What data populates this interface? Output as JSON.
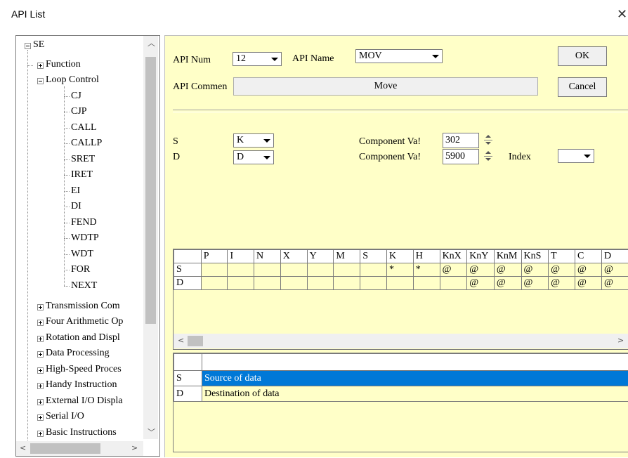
{
  "window": {
    "title": "API List",
    "close_glyph": "✕"
  },
  "tree": {
    "root": "SE",
    "items": [
      {
        "label": "Function",
        "expanded": false
      },
      {
        "label": "Loop Control",
        "expanded": true
      },
      {
        "label": "Transmission Com",
        "expanded": false
      },
      {
        "label": "Four Arithmetic Op",
        "expanded": false
      },
      {
        "label": "Rotation and Displ",
        "expanded": false
      },
      {
        "label": "Data Processing",
        "expanded": false
      },
      {
        "label": "High-Speed Proces",
        "expanded": false
      },
      {
        "label": "Handy Instruction",
        "expanded": false
      },
      {
        "label": "External I/O Displa",
        "expanded": false
      },
      {
        "label": "Serial I/O",
        "expanded": false
      },
      {
        "label": "Basic Instructions",
        "expanded": false
      }
    ],
    "children": [
      "CJ",
      "CJP",
      "CALL",
      "CALLP",
      "SRET",
      "IRET",
      "EI",
      "DI",
      "FEND",
      "WDTP",
      "WDT",
      "FOR",
      "NEXT"
    ]
  },
  "form": {
    "api_num_label": "API Num",
    "api_num_value": "12",
    "api_name_label": "API Name",
    "api_name_value": "MOV",
    "api_comment_label": "API Commen",
    "api_comment_value": "Move",
    "ok_label": "OK",
    "cancel_label": "Cancel",
    "s_label": "S",
    "s_type": "K",
    "d_label": "D",
    "d_type": "D",
    "comp_val_label_1": "Component Va!",
    "comp_val_1": "302",
    "comp_val_label_2": "Component Va!",
    "comp_val_2": "5900",
    "index_label": "Index",
    "index_value": ""
  },
  "operand_grid": {
    "columns": [
      "",
      "P",
      "I",
      "N",
      "X",
      "Y",
      "M",
      "S",
      "K",
      "H",
      "KnX",
      "KnY",
      "KnM",
      "KnS",
      "T",
      "C",
      "D"
    ],
    "rows": [
      {
        "name": "S",
        "cells": [
          "",
          "",
          "",
          "",
          "",
          "",
          "",
          "*",
          "*",
          "@",
          "@",
          "@",
          "@",
          "@",
          "@",
          "@"
        ]
      },
      {
        "name": "D",
        "cells": [
          "",
          "",
          "",
          "",
          "",
          "",
          "",
          "",
          "",
          "",
          "@",
          "@",
          "@",
          "@",
          "@",
          "@"
        ]
      }
    ]
  },
  "desc_grid": {
    "rows": [
      {
        "name": "S",
        "desc": "Source of data",
        "selected": true
      },
      {
        "name": "D",
        "desc": "Destination of data",
        "selected": false
      }
    ]
  },
  "colors": {
    "panel_bg": "#ffffc8",
    "selection": "#0078d7"
  }
}
